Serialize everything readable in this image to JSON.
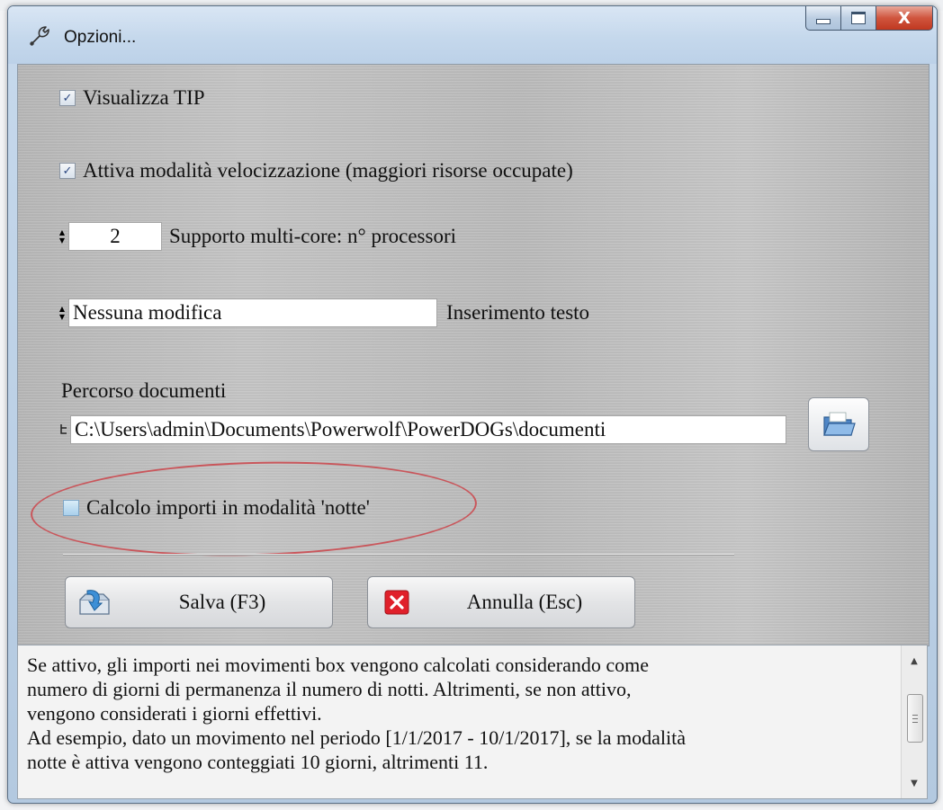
{
  "window": {
    "title": "Opzioni...",
    "close_glyph": "X"
  },
  "options": {
    "show_tip": {
      "label": "Visualizza TIP",
      "checked": true
    },
    "speed_mode": {
      "label": "Attiva modalità velocizzazione (maggiori risorse occupate)",
      "checked": true
    },
    "multicore": {
      "value": "2",
      "label": "Supporto multi-core: n° processori"
    },
    "text_insert": {
      "value": "Nessuna modifica",
      "label": "Inserimento testo"
    },
    "docs_path": {
      "label": "Percorso documenti",
      "value": "C:\\Users\\admin\\Documents\\Powerwolf\\PowerDOGs\\documenti"
    },
    "night_mode": {
      "label": "Calcolo importi in modalità 'notte'",
      "checked": false
    }
  },
  "buttons": {
    "save": "Salva (F3)",
    "cancel": "Annulla  (Esc)"
  },
  "help": {
    "lines": [
      "Se attivo, gli importi nei movimenti box vengono calcolati considerando come",
      "numero di giorni di permanenza il numero di notti. Altrimenti, se  non attivo,",
      "vengono considerati i giorni effettivi.",
      "Ad esempio, dato un movimento nel periodo [1/1/2017 -  10/1/2017], se la modalità",
      "notte è attiva vengono conteggiati 10 giorni, altrimenti 11."
    ]
  },
  "icons": {
    "title": "wrench-icon",
    "folder": "folder-open-icon",
    "save": "save-disk-icon",
    "cancel": "cancel-x-icon"
  },
  "colors": {
    "highlight_ellipse": "#c9565b",
    "close_button": "#c03820",
    "cancel_icon": "#e0202a"
  }
}
